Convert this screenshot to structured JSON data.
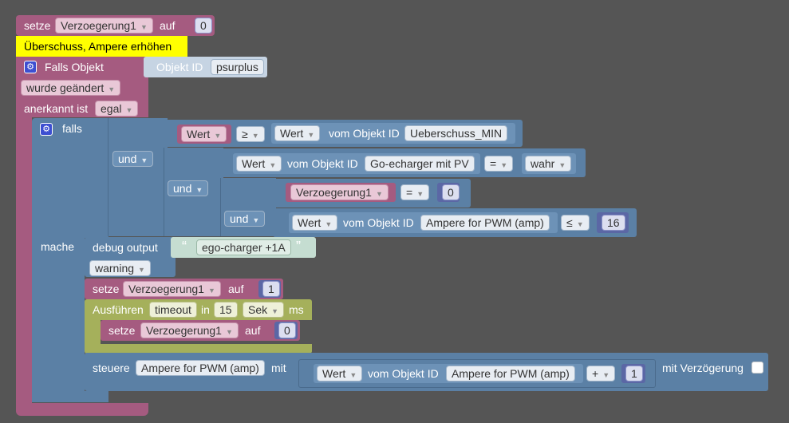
{
  "block1": {
    "verb": "setze",
    "var": "Verzoegerung1",
    "auf": "auf",
    "value": "0"
  },
  "comment": "Überschuss, Ampere erhöhen",
  "trigger": {
    "label": "Falls Objekt",
    "objid_label": "Objekt ID",
    "objid_value": "psurplus",
    "changed": "wurde geändert",
    "ack_label": "anerkannt ist",
    "ack_value": "egal"
  },
  "if": {
    "label": "falls",
    "cmp1": {
      "field": "Wert",
      "op": "≥",
      "rhs_field": "Wert",
      "rhs_label": "vom Objekt ID",
      "rhs_obj": "Ueberschuss_MIN"
    },
    "and1": "und",
    "cmp2": {
      "field": "Wert",
      "label": "vom Objekt ID",
      "obj": "Go-echarger mit PV",
      "op": "=",
      "value": "wahr"
    },
    "and2": "und",
    "cmp3": {
      "var": "Verzoegerung1",
      "op": "=",
      "value": "0"
    },
    "and3": "und",
    "cmp4": {
      "field": "Wert",
      "label": "vom Objekt ID",
      "obj": "Ampere for PWM (amp)",
      "op": "≤",
      "value": "16"
    },
    "do_label": "mache"
  },
  "debug": {
    "label": "debug output",
    "text": "ego-charger +1A",
    "level": "warning"
  },
  "set2": {
    "verb": "setze",
    "var": "Verzoegerung1",
    "auf": "auf",
    "value": "1"
  },
  "timeout": {
    "label": "Ausführen",
    "name": "timeout",
    "in": "in",
    "value": "15",
    "unit": "Sek",
    "ms": "ms"
  },
  "set3": {
    "verb": "setze",
    "var": "Verzoegerung1",
    "auf": "auf",
    "value": "0"
  },
  "control": {
    "label": "steuere",
    "obj": "Ampere for PWM (amp)",
    "mit": "mit",
    "field": "Wert",
    "vom": "vom Objekt ID",
    "obj2": "Ampere for PWM (amp)",
    "op": "+",
    "value": "1",
    "delay": "mit Verzögerung"
  }
}
